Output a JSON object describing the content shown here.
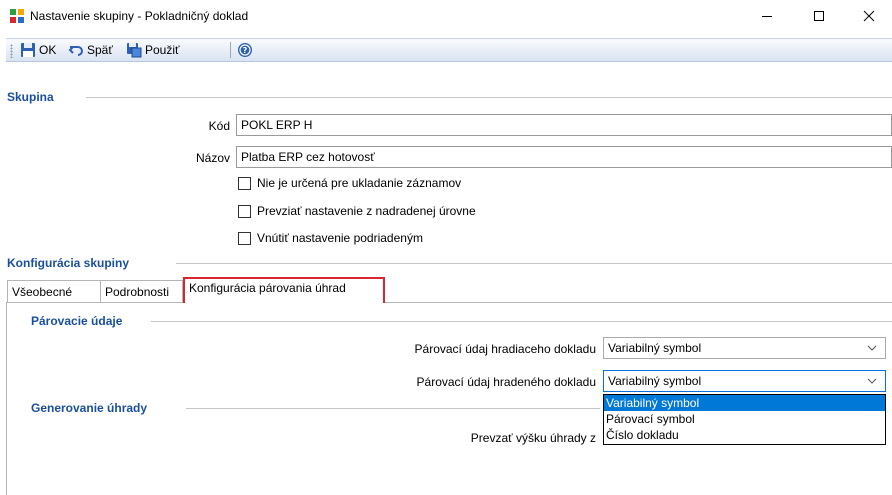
{
  "window": {
    "title": "Nastavenie skupiny - Pokladničný doklad"
  },
  "toolbar": {
    "ok_label": "OK",
    "back_label": "Späť",
    "apply_label": "Použiť"
  },
  "skupina": {
    "header": "Skupina",
    "kod_label": "Kód",
    "kod_value": "POKL ERP H",
    "nazov_label": "Názov",
    "nazov_value": "Platba ERP cez hotovosť",
    "checkboxes": [
      {
        "label": "Nie je určená pre ukladanie záznamov",
        "checked": false
      },
      {
        "label": "Prevziať nastavenie z nadradenej úrovne",
        "checked": false
      },
      {
        "label": "Vnútiť nastavenie podriadeným",
        "checked": false
      }
    ]
  },
  "konfiguracia": {
    "header": "Konfigurácia skupiny",
    "tabs": [
      {
        "label": "Všeobecné",
        "active": false
      },
      {
        "label": "Podrobnosti",
        "active": false
      },
      {
        "label": "Konfigurácia párovania úhrad",
        "active": true
      }
    ]
  },
  "parovacie": {
    "header": "Párovacie údaje",
    "hradiaci_label": "Párovací údaj hradiaceho dokladu",
    "hradiaci_value": "Variabilný symbol",
    "hradeny_label": "Párovací údaj hradeného dokladu",
    "hradeny_value": "Variabilný symbol",
    "dropdown_options": [
      "Variabilný symbol",
      "Párovací symbol",
      "Číslo dokladu"
    ],
    "dropdown_selected": "Variabilný symbol"
  },
  "generovanie": {
    "header": "Generovanie úhrady",
    "vyska_label": "Prevzať výšku úhrady z"
  },
  "colors": {
    "accent": "#1a4f9c",
    "highlight": "#0078d7",
    "annotation_red": "#d9262e"
  }
}
